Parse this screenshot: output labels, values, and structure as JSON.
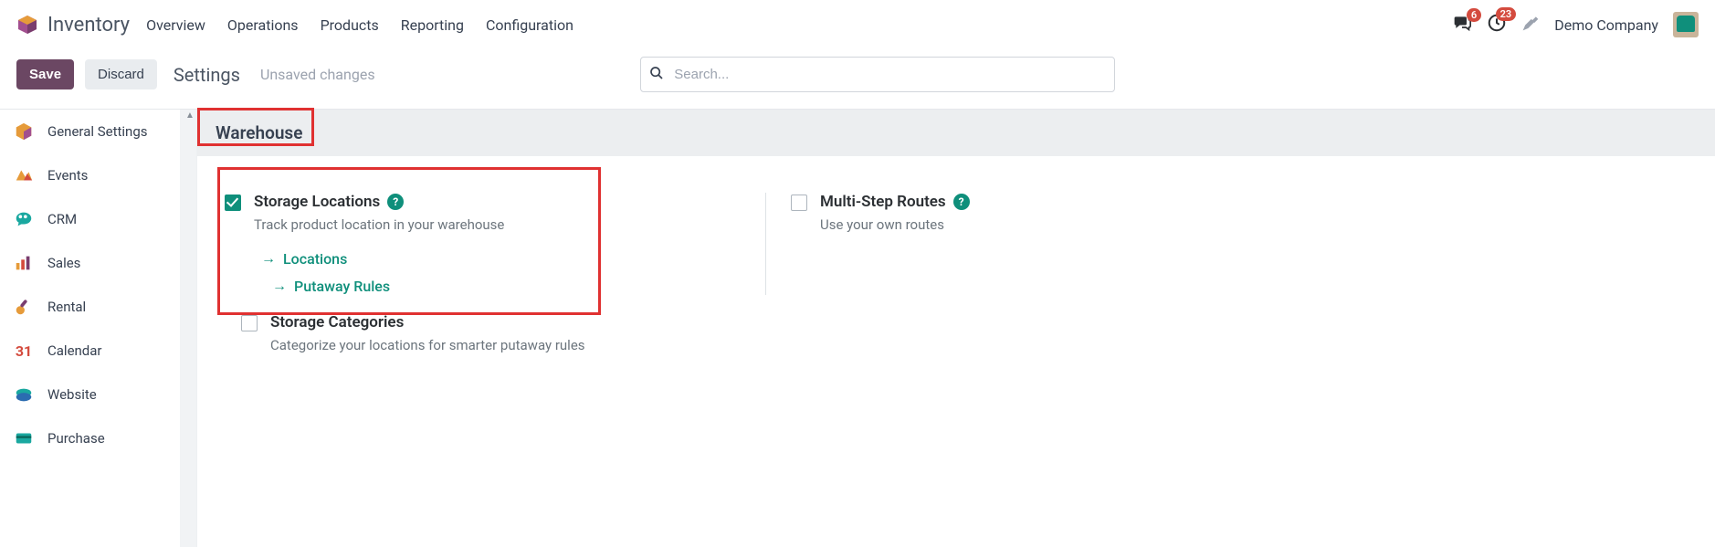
{
  "topnav": {
    "app": "Inventory",
    "links": [
      "Overview",
      "Operations",
      "Products",
      "Reporting",
      "Configuration"
    ],
    "messages_count": "6",
    "activities_count": "23",
    "company": "Demo Company"
  },
  "actionbar": {
    "save": "Save",
    "discard": "Discard",
    "breadcrumb": "Settings",
    "status": "Unsaved changes",
    "search_placeholder": "Search..."
  },
  "sidebar": {
    "items": [
      {
        "label": "General Settings"
      },
      {
        "label": "Events"
      },
      {
        "label": "CRM"
      },
      {
        "label": "Sales"
      },
      {
        "label": "Rental"
      },
      {
        "label": "Calendar"
      },
      {
        "label": "Website"
      },
      {
        "label": "Purchase"
      }
    ]
  },
  "section": {
    "title": "Warehouse"
  },
  "settings": {
    "storage_locations": {
      "title": "Storage Locations",
      "sub": "Track product location in your warehouse",
      "link1": "Locations",
      "link2": "Putaway Rules"
    },
    "multi_step": {
      "title": "Multi-Step Routes",
      "sub": "Use your own routes"
    },
    "storage_categories": {
      "title": "Storage Categories",
      "sub": "Categorize your locations for smarter putaway rules"
    }
  }
}
